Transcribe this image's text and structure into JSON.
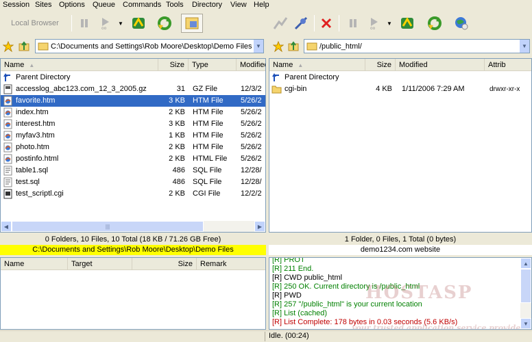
{
  "menu": [
    "Session",
    "Sites",
    "Options",
    "Queue",
    "Commands",
    "Tools",
    "Directory",
    "View",
    "Help"
  ],
  "toolbar_left": {
    "local_browser": "Local Browser"
  },
  "local": {
    "path": "C:\\Documents and Settings\\Rob Moore\\Desktop\\Demo Files",
    "columns": [
      "Name",
      "Size",
      "Type",
      "Modified"
    ],
    "rows": [
      {
        "name": "Parent Directory",
        "size": "",
        "type": "",
        "modified": "",
        "icon": "parent-dir-icon"
      },
      {
        "name": "accesslog_abc123.com_12_3_2005.gz",
        "size": "31",
        "type": "GZ File",
        "modified": "12/3/2",
        "icon": "gz-file-icon"
      },
      {
        "name": "favorite.htm",
        "size": "3 KB",
        "type": "HTM File",
        "modified": "5/26/2",
        "icon": "htm-file-icon"
      },
      {
        "name": "index.htm",
        "size": "2 KB",
        "type": "HTM File",
        "modified": "5/26/2",
        "icon": "htm-file-icon"
      },
      {
        "name": "interest.htm",
        "size": "3 KB",
        "type": "HTM File",
        "modified": "5/26/2",
        "icon": "htm-file-icon"
      },
      {
        "name": "myfav3.htm",
        "size": "1 KB",
        "type": "HTM File",
        "modified": "5/26/2",
        "icon": "htm-file-icon"
      },
      {
        "name": "photo.htm",
        "size": "2 KB",
        "type": "HTM File",
        "modified": "5/26/2",
        "icon": "htm-file-icon"
      },
      {
        "name": "postinfo.html",
        "size": "2 KB",
        "type": "HTML File",
        "modified": "5/26/2",
        "icon": "htm-file-icon"
      },
      {
        "name": "table1.sql",
        "size": "486",
        "type": "SQL File",
        "modified": "12/28/",
        "icon": "sql-file-icon"
      },
      {
        "name": "test.sql",
        "size": "486",
        "type": "SQL File",
        "modified": "12/28/",
        "icon": "sql-file-icon"
      },
      {
        "name": "test_scriptl.cgi",
        "size": "2 KB",
        "type": "CGI File",
        "modified": "12/2/2",
        "icon": "cgi-file-icon"
      }
    ],
    "summary": "0 Folders, 10 Files, 10 Total (18 KB / 71.26 GB Free)",
    "status_path": "C:\\Documents and Settings\\Rob Moore\\Desktop\\Demo Files"
  },
  "remote": {
    "path": "/public_html/",
    "columns": [
      "Name",
      "Size",
      "Modified",
      "Attrib"
    ],
    "rows": [
      {
        "name": "Parent Directory",
        "size": "",
        "modified": "",
        "attrib": "",
        "icon": "parent-dir-icon"
      },
      {
        "name": "cgi-bin",
        "size": "4 KB",
        "modified": "1/11/2006 7:29 AM",
        "attrib": "drwxr-xr-x",
        "icon": "folder-icon"
      }
    ],
    "summary": "1 Folder, 0 Files, 1 Total (0 bytes)",
    "site": "demo1234.com website"
  },
  "queue": {
    "columns": [
      "Name",
      "Target",
      "Size",
      "Remark"
    ]
  },
  "log": [
    {
      "text": "[R] PROT",
      "color": "green"
    },
    {
      "text": "[R] 211 End.",
      "color": "green"
    },
    {
      "text": "[R] CWD public_html",
      "color": "black"
    },
    {
      "text": "[R] 250 OK. Current directory is /public_html",
      "color": "green"
    },
    {
      "text": "[R] PWD",
      "color": "black"
    },
    {
      "text": "[R] 257 \"/public_html\" is your current location",
      "color": "green"
    },
    {
      "text": "[R] List (cached)",
      "color": "green"
    },
    {
      "text": "[R] List Complete: 178 bytes in 0.03 seconds (5.6 KB/s)",
      "color": "red"
    }
  ],
  "status_bar": {
    "text": "Idle. (00:24)"
  },
  "watermark": {
    "brand": "HOSTASP",
    "tagline": "your trusted application service provider"
  },
  "colors": {
    "selection": "#316ac5",
    "status_highlight": "#ffff00",
    "log_green": "#008000",
    "log_red": "#c00000"
  }
}
